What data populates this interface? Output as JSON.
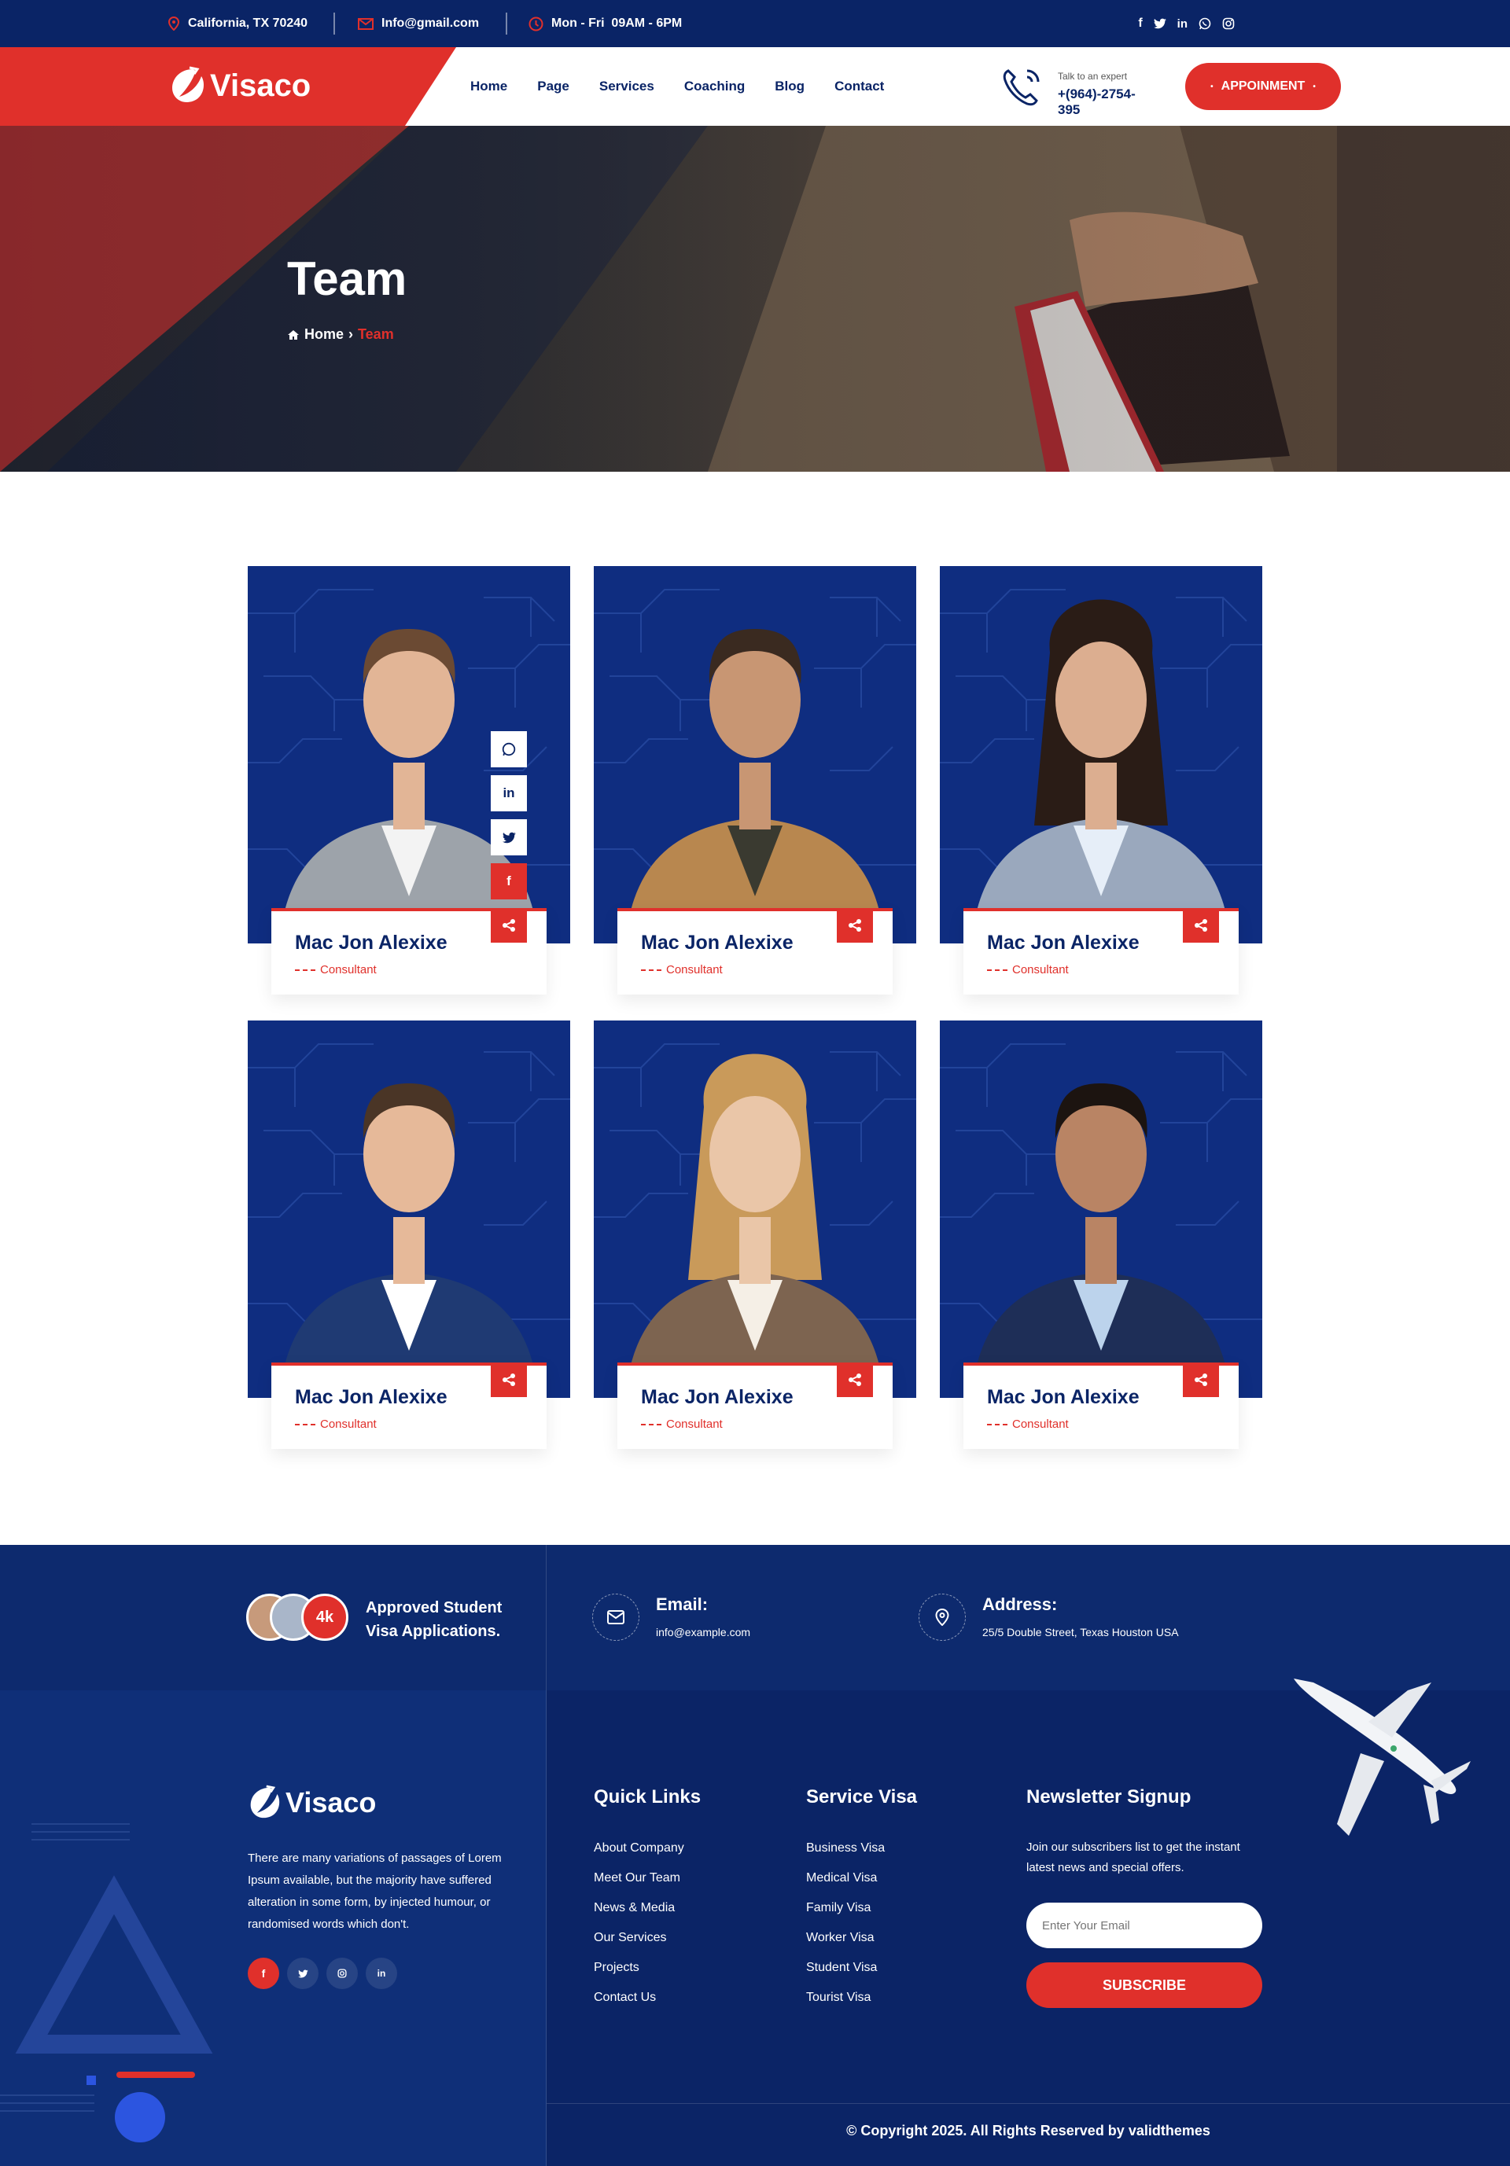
{
  "topbar": {
    "location": "California, TX 70240",
    "email": "Info@gmail.com",
    "hours": "Mon - Fri  09AM - 6PM",
    "social_icons": [
      "facebook-icon",
      "twitter-icon",
      "linkedin-icon",
      "whatsapp-icon",
      "instagram-icon"
    ]
  },
  "header": {
    "logo_text": "Visaco",
    "nav": [
      "Home",
      "Page",
      "Services",
      "Coaching",
      "Blog",
      "Contact"
    ],
    "expert_label": "Talk to an expert",
    "expert_phone": "+(964)-2754-395",
    "cta_label": "APPOINMENT"
  },
  "banner": {
    "title": "Team",
    "breadcrumb_home": "Home",
    "breadcrumb_current": "Team"
  },
  "team": [
    {
      "name": "Mac Jon Alexixe",
      "role": "Consultant"
    },
    {
      "name": "Mac Jon Alexixe",
      "role": "Consultant"
    },
    {
      "name": "Mac Jon Alexixe",
      "role": "Consultant"
    },
    {
      "name": "Mac Jon Alexixe",
      "role": "Consultant"
    },
    {
      "name": "Mac Jon Alexixe",
      "role": "Consultant"
    },
    {
      "name": "Mac Jon Alexixe",
      "role": "Consultant"
    }
  ],
  "footer": {
    "approved_count": "4k",
    "approved_text_1": "Approved Student",
    "approved_text_2": "Visa Applications.",
    "email_label": "Email:",
    "email_value": "info@example.com",
    "address_label": "Address:",
    "address_value": "25/5 Double Street, Texas Houston USA",
    "logo_text": "Visaco",
    "about": "There are many variations of passages of Lorem Ipsum available, but the majority have suffered alteration in some form, by injected humour, or randomised words which don't.",
    "quick_links_title": "Quick Links",
    "quick_links": [
      "About Company",
      "Meet Our Team",
      "News & Media",
      "Our Services",
      "Projects",
      "Contact Us"
    ],
    "service_title": "Service Visa",
    "service_links": [
      "Business Visa",
      "Medical Visa",
      "Family Visa",
      "Worker Visa",
      "Student Visa",
      "Tourist Visa"
    ],
    "newsletter_title": "Newsletter Signup",
    "newsletter_text": "Join our subscribers list to get the instant latest news and special offers.",
    "email_placeholder": "Enter Your Email",
    "subscribe_label": "SUBSCRIBE",
    "copyright": "© Copyright 2025. All Rights Reserved by validthemes"
  },
  "colors": {
    "navy": "#0a2466",
    "red": "#e0302b",
    "card_bg": "#0f2d80"
  }
}
